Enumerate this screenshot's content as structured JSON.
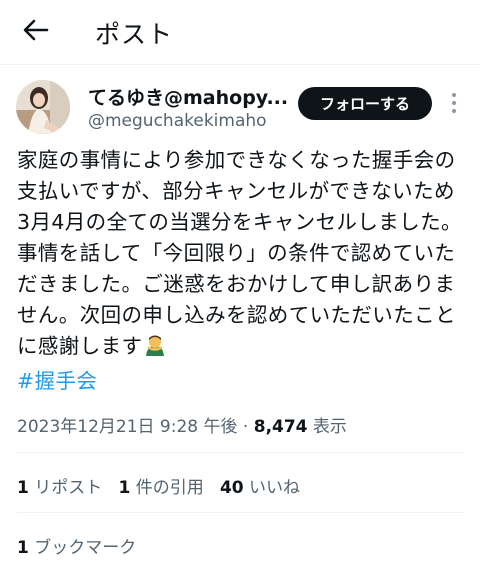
{
  "header": {
    "title": "ポスト",
    "back_icon": "arrow-left-icon"
  },
  "author": {
    "display_name": "てるゆき@mahopy...",
    "handle": "@meguchakekimaho",
    "follow_label": "フォローする",
    "more_icon": "more-vertical-icon"
  },
  "tweet": {
    "text": "家庭の事情により参加できなくなった握手会の支払いですが、部分キャンセルができないため3月4月の全ての当選分をキャンセルしました。事情を話して「今回限り」の条件で認めていただきました。ご迷惑をおかけして申し訳ありません。次回の申し込みを認めていただいたことに感謝します",
    "emoji": "person-bowing-emoji",
    "hashtag": "#握手会"
  },
  "meta": {
    "timestamp": "2023年12月21日 9:28 午後",
    "separator": "·",
    "views_count": "8,474",
    "views_label": "表示"
  },
  "stats": {
    "reposts_count": "1",
    "reposts_label": "リポスト",
    "quotes_count": "1",
    "quotes_label": "件の引用",
    "likes_count": "40",
    "likes_label": "いいね",
    "bookmarks_count": "1",
    "bookmarks_label": "ブックマーク"
  },
  "colors": {
    "text": "#0f1419",
    "secondary": "#536471",
    "accent": "#1d9bf0",
    "follow_bg": "#0f1419",
    "divider": "#eff3f4"
  }
}
